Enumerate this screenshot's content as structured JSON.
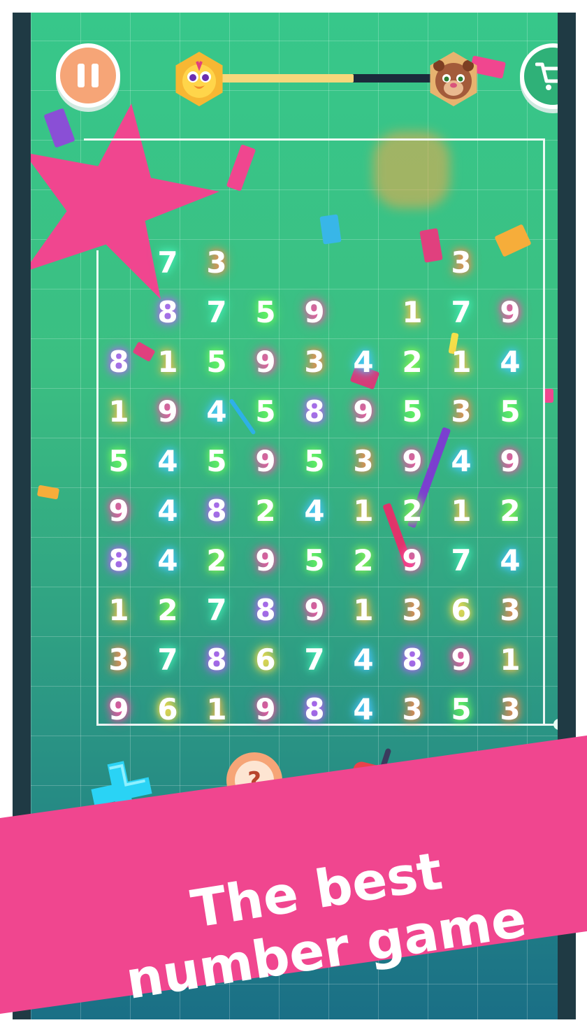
{
  "header": {
    "progress_fraction": 0.62,
    "pause_icon": "pause-icon",
    "cart_icon": "cart-icon",
    "left_avatar": "chick-avatar",
    "right_avatar": "bear-avatar"
  },
  "board": {
    "rows": [
      [
        "",
        "7",
        "3",
        "",
        "",
        "",
        "",
        "3",
        ""
      ],
      [
        "",
        "8",
        "7",
        "5",
        "9",
        "",
        "1",
        "7",
        "9"
      ],
      [
        "8",
        "1",
        "5",
        "9",
        "3",
        "4",
        "2",
        "1",
        "4"
      ],
      [
        "1",
        "9",
        "4",
        "5",
        "8",
        "9",
        "5",
        "3",
        "5"
      ],
      [
        "5",
        "4",
        "5",
        "9",
        "5",
        "3",
        "9",
        "4",
        "9"
      ],
      [
        "9",
        "4",
        "8",
        "2",
        "4",
        "1",
        "2",
        "1",
        "2"
      ],
      [
        "8",
        "4",
        "2",
        "9",
        "5",
        "2",
        "9",
        "7",
        "4"
      ],
      [
        "1",
        "2",
        "7",
        "8",
        "9",
        "1",
        "3",
        "6",
        "3"
      ],
      [
        "3",
        "7",
        "8",
        "6",
        "7",
        "4",
        "8",
        "9",
        "1"
      ],
      [
        "9",
        "6",
        "1",
        "9",
        "8",
        "4",
        "3",
        "5",
        "3"
      ]
    ]
  },
  "tools": [
    {
      "name": "add-rows-icon"
    },
    {
      "name": "hint-icon",
      "symbol": "?"
    },
    {
      "name": "walkie-talkie-icon"
    },
    {
      "name": "shuffle-arrow-icon"
    }
  ],
  "banner": {
    "line1": "The best",
    "line2": "number game"
  },
  "colors": {
    "accent_pink": "#f0468f",
    "pause_orange": "#f6a577",
    "cart_green": "#2fb178",
    "progress_yellow": "#f7d77b"
  }
}
